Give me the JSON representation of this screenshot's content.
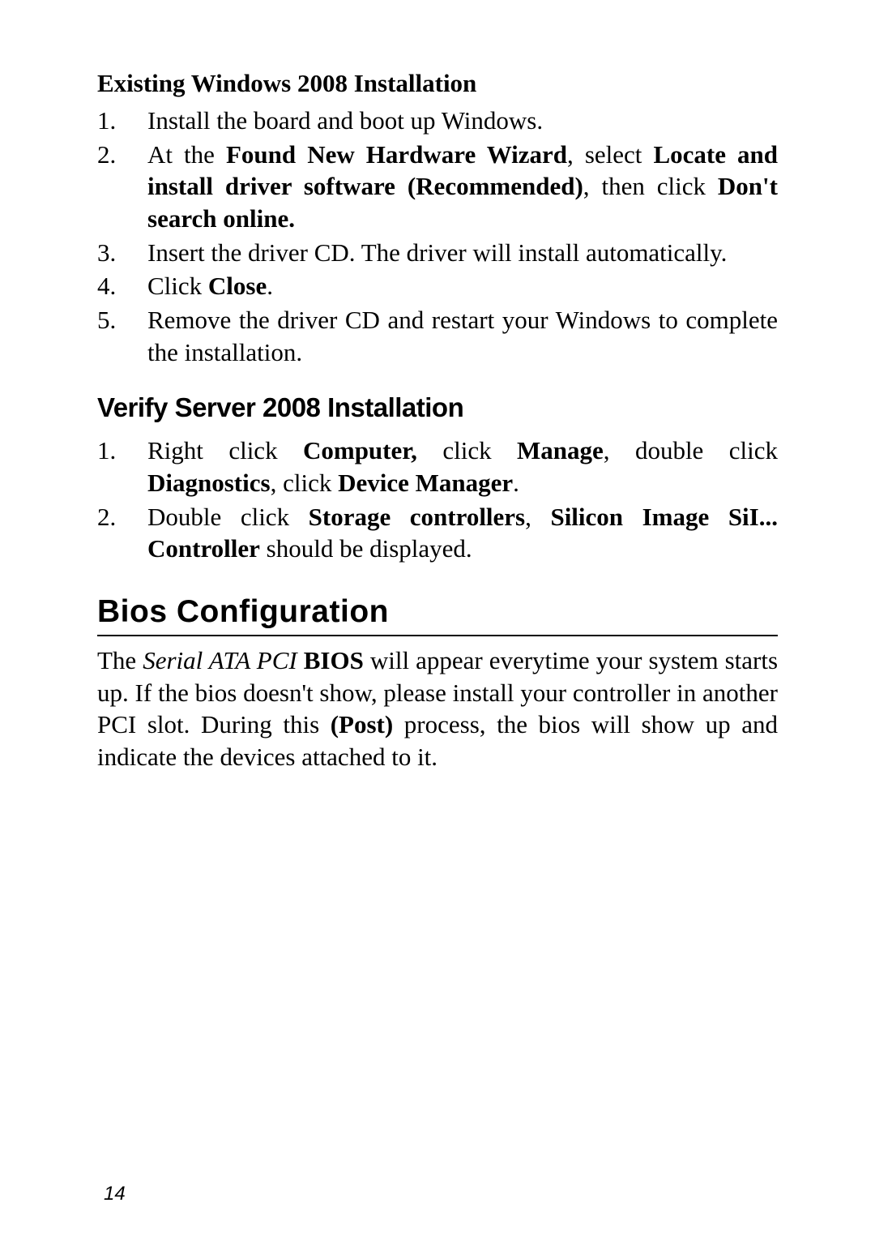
{
  "section1": {
    "heading": "Existing Windows 2008 Installation",
    "items": [
      {
        "num": "1.",
        "text": "Install the board and boot up Windows."
      },
      {
        "num": "2.",
        "t1": "At the ",
        "b1": "Found New Hardware Wizard",
        "t2": ", select ",
        "b2": "Locate and install driver software (Recommended)",
        "t3": ", then click ",
        "b3": "Don't search online."
      },
      {
        "num": "3.",
        "text": "Insert the driver CD.  The driver will install automatically."
      },
      {
        "num": "4.",
        "t1": "Click ",
        "b1": "Close",
        "t2": "."
      },
      {
        "num": "5.",
        "text": "Remove the driver CD and restart your Windows to complete the installation."
      }
    ]
  },
  "section2": {
    "heading": "Verify Server 2008 Installation",
    "items": [
      {
        "num": "1.",
        "t1": "Right click ",
        "b1": "Computer,",
        "t2": " click ",
        "b2": "Manage",
        "t3": ", double click ",
        "b3": "Diagnostics",
        "t4": ", click ",
        "b4": "Device Manager",
        "t5": "."
      },
      {
        "num": "2.",
        "t1": "Double click ",
        "b1": "Storage controllers",
        "t2": ", ",
        "b2": "Silicon Image SiI... Controller",
        "t3": " should be displayed."
      }
    ]
  },
  "bios": {
    "heading": "Bios  Configuration",
    "para": {
      "t1": "The ",
      "i1": "Serial ATA PCI",
      "t2": " ",
      "b1": "BIOS",
      "t3": " will appear everytime your system starts up.  If the bios doesn't show, please install your controller in another PCI slot.  During this ",
      "b2": "(Post)",
      "t4": " process, the bios will show up and indicate the devices attached to it."
    }
  },
  "pageNumber": "14"
}
